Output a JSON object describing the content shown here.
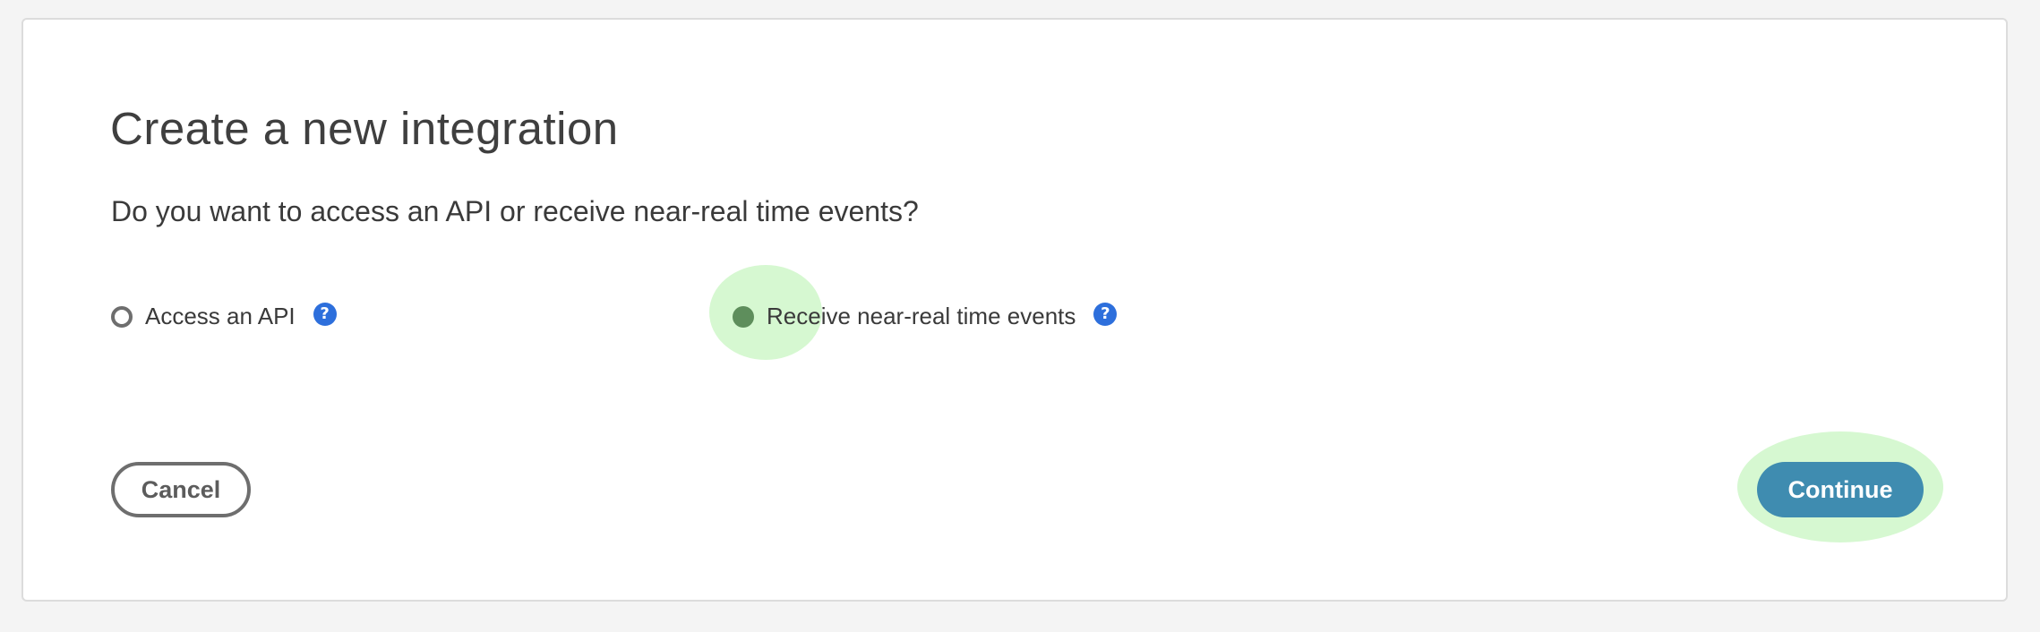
{
  "dialog": {
    "title": "Create a new integration",
    "question": "Do you want to access an API or receive near-real time events?"
  },
  "options": [
    {
      "label": "Access an API",
      "selected": false,
      "help_icon": "question-circle-icon",
      "help_glyph": "?"
    },
    {
      "label": "Receive near-real time events",
      "selected": true,
      "help_icon": "question-circle-icon",
      "help_glyph": "?"
    }
  ],
  "actions": {
    "cancel_label": "Cancel",
    "continue_label": "Continue"
  },
  "colors": {
    "accent": "#3f8cb0",
    "help": "#2d6fdc",
    "highlight": "#d6f8d1",
    "selected_radio": "#5e8e5c"
  }
}
